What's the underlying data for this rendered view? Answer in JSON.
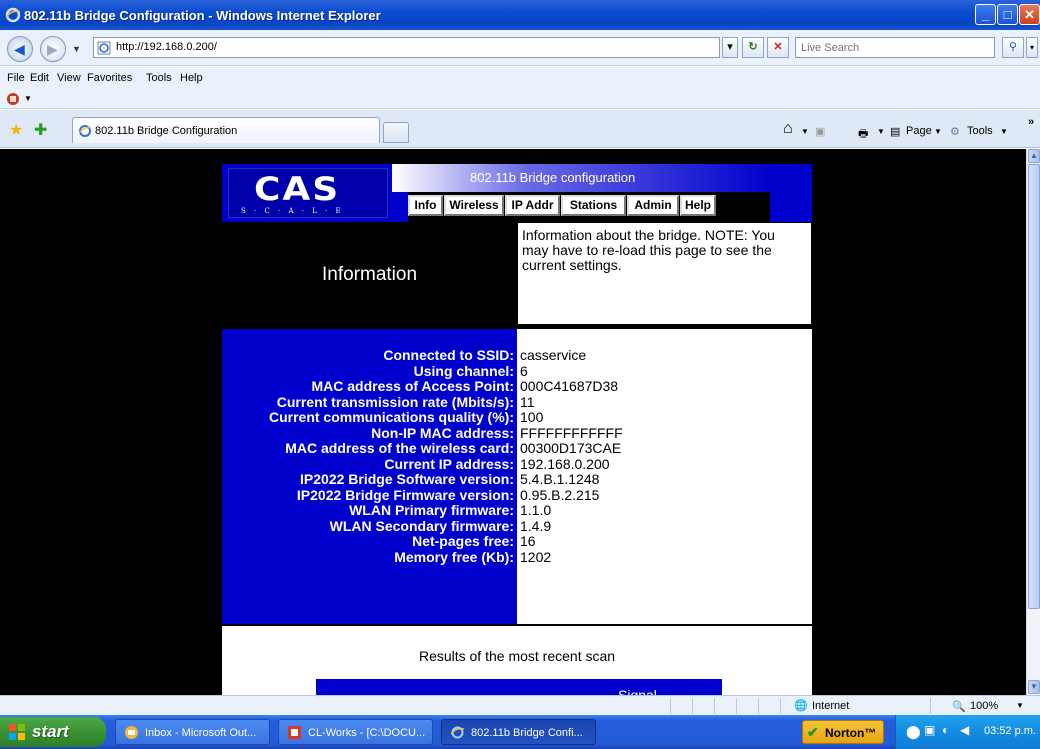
{
  "window": {
    "title": "802.11b Bridge Configuration - Windows Internet Explorer"
  },
  "addressbar": {
    "url": "http://192.168.0.200/",
    "search_placeholder": "Live Search"
  },
  "menu": [
    "File",
    "Edit",
    "View",
    "Favorites",
    "Tools",
    "Help"
  ],
  "tab": {
    "label": "802.11b Bridge Configuration"
  },
  "commandbar": {
    "page_label": "Page",
    "tools_label": "Tools"
  },
  "page": {
    "logo_text": "CAS",
    "logo_sub": "S · C · A · L · E",
    "header_title": "802.11b Bridge configuration",
    "nav": [
      "Info",
      "Wireless",
      "IP Addr",
      "Stations",
      "Admin",
      "Help"
    ],
    "info_heading": "Information",
    "info_note": "Information about the bridge. NOTE: You may have to re-load this page to see the current settings.",
    "details": [
      {
        "label": "Connected to SSID:",
        "value": "casservice"
      },
      {
        "label": "Using channel:",
        "value": "6"
      },
      {
        "label": "MAC address of Access Point:",
        "value": "000C41687D38"
      },
      {
        "label": "Current transmission rate (Mbits/s):",
        "value": "11"
      },
      {
        "label": "Current communications quality (%):",
        "value": "100"
      },
      {
        "label": "Non-IP MAC address:",
        "value": "FFFFFFFFFFFF"
      },
      {
        "label": "MAC address of the wireless card:",
        "value": "00300D173CAE"
      },
      {
        "label": "Current IP address:",
        "value": "192.168.0.200"
      },
      {
        "label": "IP2022 Bridge Software version:",
        "value": "5.4.B.1.1248"
      },
      {
        "label": "IP2022 Bridge Firmware version:",
        "value": "0.95.B.2.215"
      },
      {
        "label": "WLAN Primary firmware:",
        "value": "1.1.0"
      },
      {
        "label": "WLAN Secondary firmware:",
        "value": "1.4.9"
      },
      {
        "label": "Net-pages free:",
        "value": "16"
      },
      {
        "label": "Memory free (Kb):",
        "value": "1202"
      }
    ],
    "results_title": "Results of the most recent scan",
    "scan_col_signal": "Signal"
  },
  "statusbar": {
    "zone": "Internet",
    "zoom": "100%"
  },
  "taskbar": {
    "start": "start",
    "tasks": [
      "Inbox - Microsoft Out...",
      "CL-Works - [C:\\DOCU...",
      "802.11b Bridge Confi..."
    ],
    "norton": "Norton™",
    "clock": "03:52 p.m."
  }
}
